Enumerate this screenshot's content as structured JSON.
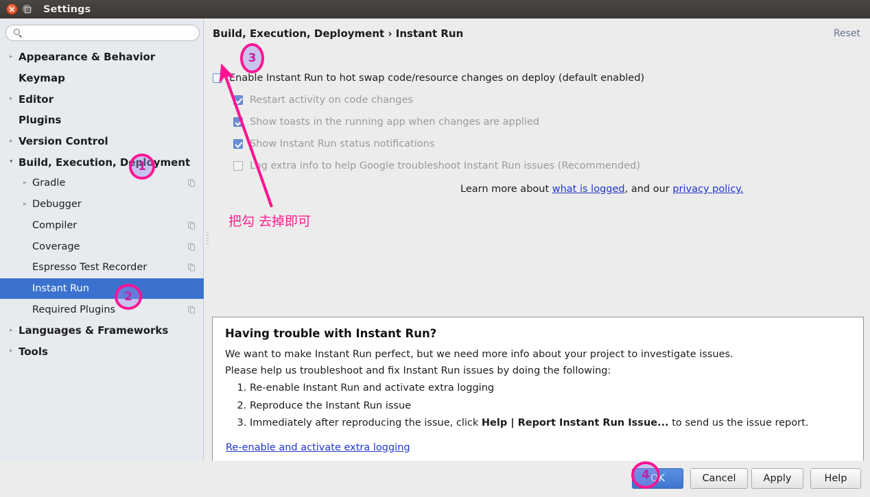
{
  "window": {
    "title": "Settings",
    "close_icon": "close-icon",
    "maximize_icon": "maximize-icon"
  },
  "sidebar": {
    "search": {
      "value": "",
      "placeholder": "",
      "icon": "search-icon"
    },
    "items": [
      {
        "label": "Appearance & Behavior",
        "level": "top",
        "arrow": "▸",
        "expanded": false,
        "selected": false,
        "copy_icon": false
      },
      {
        "label": "Keymap",
        "level": "top",
        "arrow": "",
        "expanded": false,
        "selected": false,
        "copy_icon": false
      },
      {
        "label": "Editor",
        "level": "top",
        "arrow": "▸",
        "expanded": false,
        "selected": false,
        "copy_icon": false
      },
      {
        "label": "Plugins",
        "level": "top",
        "arrow": "",
        "expanded": false,
        "selected": false,
        "copy_icon": false
      },
      {
        "label": "Version Control",
        "level": "top",
        "arrow": "▸",
        "expanded": false,
        "selected": false,
        "copy_icon": false
      },
      {
        "label": "Build, Execution, Deployment",
        "level": "top",
        "arrow": "▾",
        "expanded": true,
        "selected": false,
        "copy_icon": false
      },
      {
        "label": "Gradle",
        "level": "child",
        "arrow": "▸",
        "expanded": false,
        "selected": false,
        "copy_icon": true
      },
      {
        "label": "Debugger",
        "level": "child",
        "arrow": "▸",
        "expanded": false,
        "selected": false,
        "copy_icon": false
      },
      {
        "label": "Compiler",
        "level": "child",
        "arrow": "",
        "expanded": false,
        "selected": false,
        "copy_icon": true
      },
      {
        "label": "Coverage",
        "level": "child",
        "arrow": "",
        "expanded": false,
        "selected": false,
        "copy_icon": true
      },
      {
        "label": "Espresso Test Recorder",
        "level": "child",
        "arrow": "",
        "expanded": false,
        "selected": false,
        "copy_icon": true
      },
      {
        "label": "Instant Run",
        "level": "child",
        "arrow": "",
        "expanded": false,
        "selected": true,
        "copy_icon": false
      },
      {
        "label": "Required Plugins",
        "level": "child",
        "arrow": "",
        "expanded": false,
        "selected": false,
        "copy_icon": true
      },
      {
        "label": "Languages & Frameworks",
        "level": "top",
        "arrow": "▸",
        "expanded": false,
        "selected": false,
        "copy_icon": false
      },
      {
        "label": "Tools",
        "level": "top",
        "arrow": "▸",
        "expanded": false,
        "selected": false,
        "copy_icon": false
      }
    ]
  },
  "main": {
    "breadcrumb": "Build, Execution, Deployment › Instant Run",
    "reset_label": "Reset",
    "options": [
      {
        "label": "Enable Instant Run to hot swap code/resource changes on deploy (default enabled)",
        "checked": false,
        "disabled": false,
        "indent": false
      },
      {
        "label": "Restart activity on code changes",
        "checked": true,
        "disabled": true,
        "indent": true
      },
      {
        "label": "Show toasts in the running app when changes are applied",
        "checked": true,
        "disabled": true,
        "indent": true
      },
      {
        "label": "Show Instant Run status notifications",
        "checked": true,
        "disabled": true,
        "indent": true
      },
      {
        "label": "Log extra info to help Google troubleshoot Instant Run issues (Recommended)",
        "checked": false,
        "disabled": true,
        "indent": true
      }
    ],
    "learn_more": {
      "prefix": "Learn more about ",
      "link1": "what is logged",
      "middle": ", and our ",
      "link2": "privacy policy.",
      "suffix": ""
    }
  },
  "annotations": {
    "note_text": "把勾 去掉即可",
    "color": "#ff1493",
    "markers": [
      {
        "id": "1",
        "label": "1"
      },
      {
        "id": "2",
        "label": "2"
      },
      {
        "id": "3",
        "label": "3"
      },
      {
        "id": "4",
        "label": "4"
      }
    ]
  },
  "trouble": {
    "heading": "Having trouble with Instant Run?",
    "paragraph1": "We want to make Instant Run perfect, but we need more info about your project to investigate issues.",
    "paragraph2": "Please help us troubleshoot and fix Instant Run issues by doing the following:",
    "steps": [
      {
        "plain": "Re-enable Instant Run and activate extra logging",
        "bold": "",
        "tail": ""
      },
      {
        "plain": "Reproduce the Instant Run issue",
        "bold": "",
        "tail": ""
      },
      {
        "plain": "Immediately after reproducing the issue, click ",
        "bold": "Help | Report Instant Run Issue...",
        "tail": " to send us the issue report."
      }
    ],
    "link": "Re-enable and activate extra logging"
  },
  "footer": {
    "ok": "OK",
    "cancel": "Cancel",
    "apply": "Apply",
    "help": "Help"
  }
}
